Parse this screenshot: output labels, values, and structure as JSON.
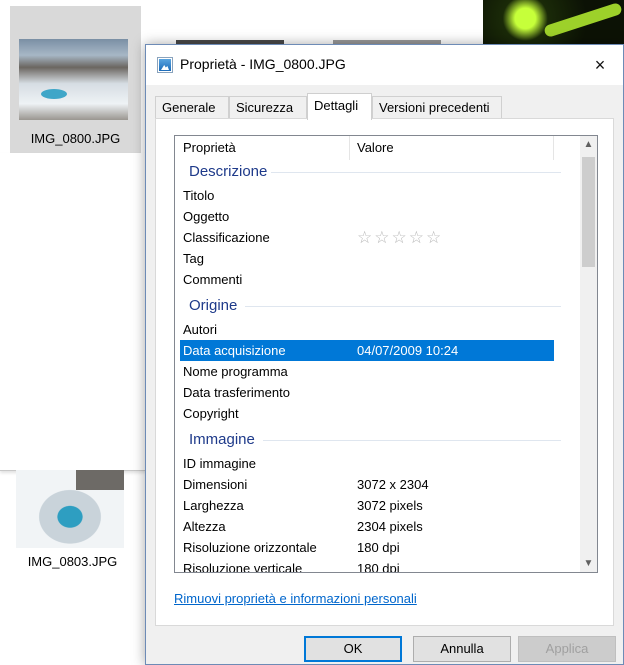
{
  "explorer": {
    "files": [
      {
        "name": "IMG_0800.JPG"
      },
      {
        "name": "IMG_0803.JPG"
      }
    ]
  },
  "dialog": {
    "title": "Proprietà - IMG_0800.JPG",
    "close_icon": "×",
    "tabs": [
      {
        "label": "Generale"
      },
      {
        "label": "Sicurezza"
      },
      {
        "label": "Dettagli",
        "active": true
      },
      {
        "label": "Versioni precedenti"
      }
    ],
    "columns": {
      "property": "Proprietà",
      "value": "Valore"
    },
    "groups": {
      "descrizione": {
        "title": "Descrizione",
        "rows": [
          {
            "key": "Titolo",
            "value": ""
          },
          {
            "key": "Oggetto",
            "value": ""
          },
          {
            "key": "Classificazione",
            "value": "",
            "stars": "☆☆☆☆☆",
            "rating": 0
          },
          {
            "key": "Tag",
            "value": ""
          },
          {
            "key": "Commenti",
            "value": ""
          }
        ]
      },
      "origine": {
        "title": "Origine",
        "rows": [
          {
            "key": "Autori",
            "value": ""
          },
          {
            "key": "Data acquisizione",
            "value": "04/07/2009 10:24",
            "selected": true
          },
          {
            "key": "Nome programma",
            "value": ""
          },
          {
            "key": "Data trasferimento",
            "value": ""
          },
          {
            "key": "Copyright",
            "value": ""
          }
        ]
      },
      "immagine": {
        "title": "Immagine",
        "rows": [
          {
            "key": "ID immagine",
            "value": ""
          },
          {
            "key": "Dimensioni",
            "value": "3072 x 2304"
          },
          {
            "key": "Larghezza",
            "value": "3072 pixels"
          },
          {
            "key": "Altezza",
            "value": "2304 pixels"
          },
          {
            "key": "Risoluzione orizzontale",
            "value": "180 dpi"
          },
          {
            "key": "Risoluzione verticale",
            "value": "180 dpi"
          }
        ]
      }
    },
    "scroll_icons": {
      "up": "▲",
      "down": "▼"
    },
    "remove_link": "Rimuovi proprietà e informazioni personali",
    "buttons": {
      "ok": "OK",
      "cancel": "Annulla",
      "apply": "Applica"
    }
  },
  "colors": {
    "selection": "#0078d7",
    "group_header": "#1e3a8a",
    "link": "#0066cc"
  }
}
